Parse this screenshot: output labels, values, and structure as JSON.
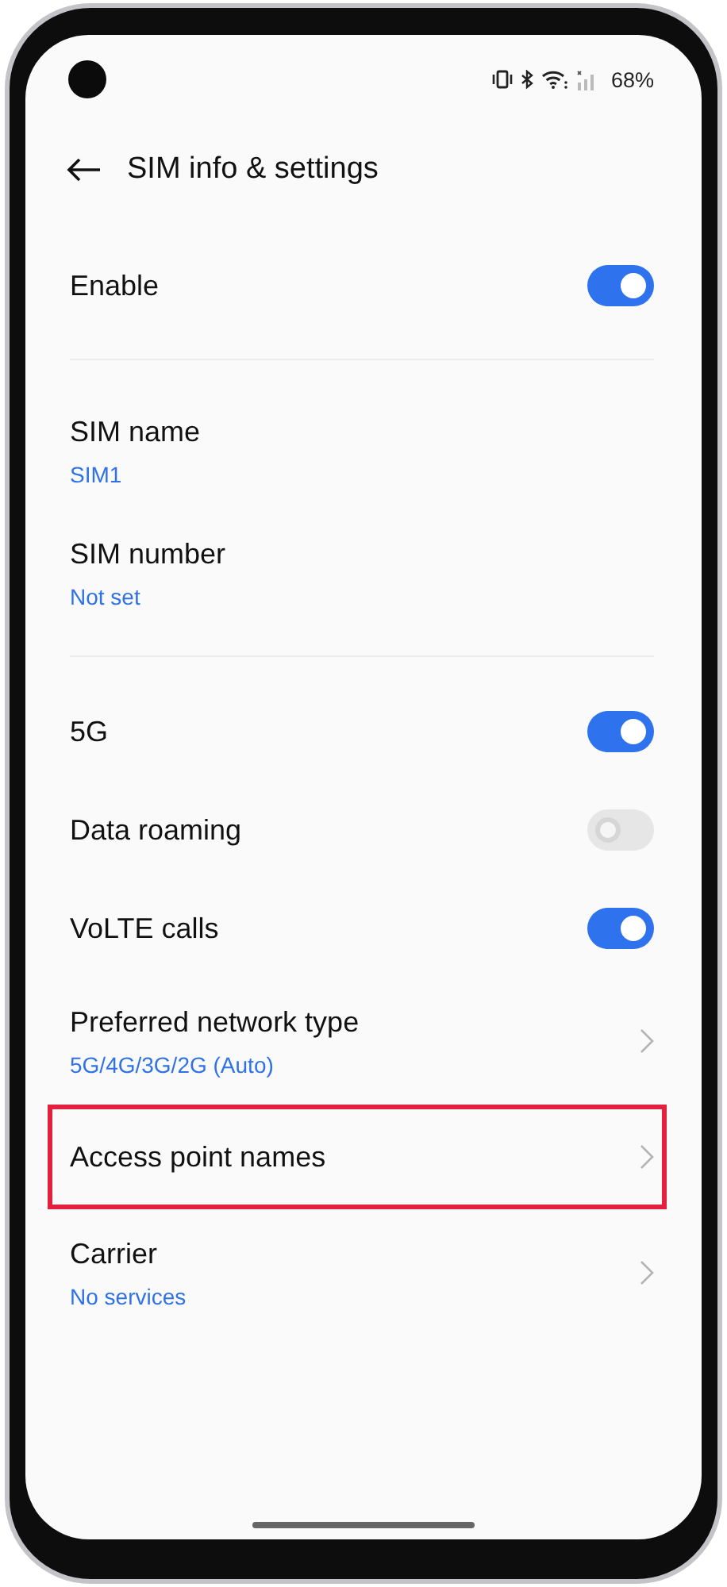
{
  "status_bar": {
    "battery": "68%"
  },
  "header": {
    "title": "SIM info & settings"
  },
  "sections": [
    {
      "items": [
        {
          "kind": "toggle",
          "title": "Enable",
          "on": true,
          "disabled": false
        }
      ]
    },
    {
      "items": [
        {
          "kind": "value",
          "title": "SIM name",
          "value": "SIM1"
        },
        {
          "kind": "value",
          "title": "SIM number",
          "value": "Not set"
        }
      ]
    },
    {
      "items": [
        {
          "kind": "toggle",
          "title": "5G",
          "on": true,
          "disabled": false
        },
        {
          "kind": "toggle",
          "title": "Data roaming",
          "on": false,
          "disabled": true
        },
        {
          "kind": "toggle",
          "title": "VoLTE calls",
          "on": true,
          "disabled": false
        },
        {
          "kind": "nav",
          "title": "Preferred network type",
          "value": "5G/4G/3G/2G (Auto)",
          "highlighted": false
        },
        {
          "kind": "nav",
          "title": "Access point names",
          "highlighted": true
        },
        {
          "kind": "nav",
          "title": "Carrier",
          "value": "No services",
          "highlighted": false
        }
      ]
    }
  ]
}
